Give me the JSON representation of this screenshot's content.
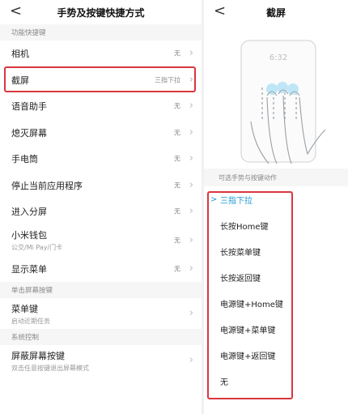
{
  "left": {
    "back_glyph": "<",
    "title": "手势及按键快捷方式",
    "section1": "功能快捷键",
    "rows": [
      {
        "label": "相机",
        "value": "无"
      },
      {
        "label": "截屏",
        "value": "三指下拉"
      },
      {
        "label": "语音助手",
        "value": "无"
      },
      {
        "label": "熄灭屏幕",
        "value": "无"
      },
      {
        "label": "手电筒",
        "value": "无"
      },
      {
        "label": "停止当前应用程序",
        "value": "无"
      },
      {
        "label": "进入分屏",
        "value": "无"
      },
      {
        "label": "小米钱包",
        "sub": "公交/Mi Pay/门卡",
        "value": "无"
      },
      {
        "label": "显示菜单",
        "value": "无"
      }
    ],
    "section2": "单击屏幕按键",
    "menu_key": {
      "label": "菜单键",
      "sub": "启动近期任务"
    },
    "section3": "系统控制",
    "mask_key": {
      "label": "屏蔽屏幕按键",
      "sub": "双击任意按键退出屏幕模式"
    }
  },
  "right": {
    "back_glyph": "<",
    "title": "截屏",
    "phone_time": "6:32",
    "options_header": "可选手势与按键动作",
    "options": [
      "三指下拉",
      "长按Home键",
      "长按菜单键",
      "长按返回键",
      "电源键+Home键",
      "电源键+菜单键",
      "电源键+返回键",
      "无"
    ],
    "selected_index": 0,
    "check_glyph": ">"
  },
  "chevron_glyph": "›",
  "colors": {
    "accent": "#1a9ad6",
    "highlight": "#d9363e"
  }
}
